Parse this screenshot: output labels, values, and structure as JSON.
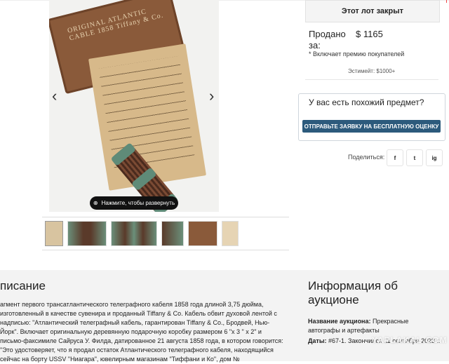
{
  "gallery": {
    "prev_arrow": "‹",
    "next_arrow": "›",
    "box_lid_text": "ORIGINAL ATLANTIC CABLE 1858 Tiffany & Co.",
    "expand_label": "Нажмите, чтобы развернуть",
    "thumbnails": [
      "photo-letter-cable",
      "photo-cable-1",
      "photo-cable-2",
      "photo-cable-3",
      "photo-box",
      "photo-letter"
    ]
  },
  "lot": {
    "status": "Этот лот закрыт",
    "sold_label": "Продано за:",
    "sold_price": "$ 1165",
    "premium_note": "* Включает премию покупателей",
    "estimate": "Эстимейт: $1000+"
  },
  "similar": {
    "title": "У вас есть похожий предмет?",
    "button": "ОТПРАВЬТЕ ЗАЯВКУ НА БЕСПЛАТНУЮ ОЦЕНКУ"
  },
  "share": {
    "label": "Поделиться:",
    "icons": [
      "f",
      "t",
      "ig"
    ]
  },
  "description": {
    "title": "писание",
    "text": "агмент первого трансатлантического телеграфного кабеля 1858 года длиной 3,75 дюйма, изготовленный в качестве сувенира и проданный Tiffany & Co. Кабель обвит духовой лентой с надписью: \"Атлантический телеграфный кабель, гарантирован Tiffany & Co., Бродвей, Нью-Йорк\". Включает оригинальную деревянную подарочную коробку размером 6 \"x 3 \" x 2\" и письмо-факсимиле Сайруса У. Филда, датированное 21 августа 1858 года, в котором говорится: \"Это удостоверяет, что я продал остаток Атлантического телеграфного кабеля, находящийся сейчас на борту USSV \"Ниагара\", ювелирным магазинам \"Тиффани и Ко\", дом №"
  },
  "auction_info": {
    "title": "Информация об аукционе",
    "name_label": "Название аукциона:",
    "name_value": "Прекрасные автографы и артефакты",
    "dates_label": "Даты:",
    "dates_value": "#67-1. Закончился 11 сентября 2023 г."
  },
  "watermark": "YAPLAKAL.COM",
  "colors": {
    "accent_button": "#2c5a7c",
    "lower_bg": "#f3f3f3"
  }
}
